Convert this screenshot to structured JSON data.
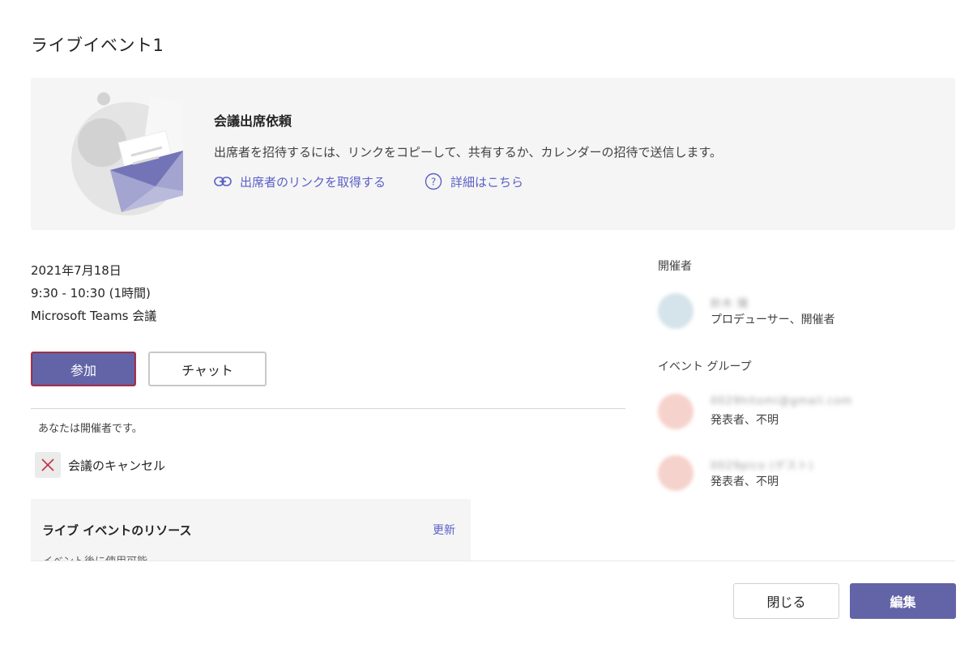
{
  "dialog": {
    "title": "ライブイベント1"
  },
  "invite": {
    "heading": "会議出席依頼",
    "description": "出席者を招待するには、リンクをコピーして、共有するか、カレンダーの招待で送信します。",
    "get_link_label": "出席者のリンクを取得する",
    "details_label": "詳細はこちら",
    "icons": {
      "link": "link-icon",
      "help": "help-circle-icon"
    }
  },
  "event": {
    "date": "2021年7月18日",
    "time": "9:30 - 10:30 (1時間)",
    "type": "Microsoft Teams 会議"
  },
  "actions": {
    "join_label": "参加",
    "chat_label": "チャット",
    "organizer_note": "あなたは開催者です。",
    "cancel_label": "会議のキャンセル"
  },
  "resources": {
    "title": "ライブ イベントのリソース",
    "refresh_label": "更新",
    "subtitle": "イベント後に使用可能"
  },
  "sidebar": {
    "organizer_heading": "開催者",
    "organizer": {
      "name": "鈴木 陽",
      "role": "プロデューサー、開催者",
      "avatar_color": "#d5e3ea"
    },
    "group_heading": "イベント グループ",
    "group_members": [
      {
        "name": "0029hitomi@gmail.com",
        "role": "発表者、不明",
        "avatar_color": "#f6d2cc"
      },
      {
        "name": "0029pico (ゲスト)",
        "role": "発表者、不明",
        "avatar_color": "#f6d2cc"
      }
    ]
  },
  "footer": {
    "close_label": "閉じる",
    "edit_label": "編集"
  },
  "colors": {
    "accent": "#6264a7",
    "link": "#5b5fc7",
    "panel_bg": "#f5f5f5",
    "cancel_x": "#c4314b"
  }
}
